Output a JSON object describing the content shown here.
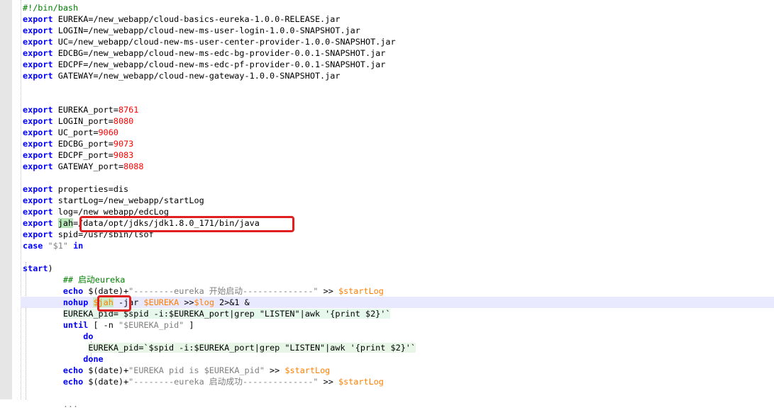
{
  "editor": {
    "lines": [
      [
        {
          "t": "#!/bin/bash",
          "c": "cm"
        }
      ],
      [
        {
          "t": "export",
          "c": "kw"
        },
        {
          "t": " EUREKA=/new_webapp/cloud-basics-eureka-1.0.0-RELEASE.jar"
        }
      ],
      [
        {
          "t": "export",
          "c": "kw"
        },
        {
          "t": " LOGIN=/new_webapp/cloud-new-ms-user-login-1.0.0-SNAPSHOT.jar"
        }
      ],
      [
        {
          "t": "export",
          "c": "kw"
        },
        {
          "t": " UC=/new_webapp/cloud-new-ms-user-center-provider-1.0.0-SNAPSHOT.jar"
        }
      ],
      [
        {
          "t": "export",
          "c": "kw"
        },
        {
          "t": " EDCBG=/new_webapp/cloud-new-ms-edc-bg-provider-0.0.1-SNAPSHOT.jar"
        }
      ],
      [
        {
          "t": "export",
          "c": "kw"
        },
        {
          "t": " EDCPF=/new_webapp/cloud-new-ms-edc-pf-provider-0.0.1-SNAPSHOT.jar"
        }
      ],
      [
        {
          "t": "export",
          "c": "kw"
        },
        {
          "t": " GATEWAY=/new_webapp/cloud-new-gateway-1.0.0-SNAPSHOT.jar"
        }
      ],
      [],
      [],
      [
        {
          "t": "export",
          "c": "kw"
        },
        {
          "t": " EUREKA_port="
        },
        {
          "t": "8761",
          "c": "num"
        }
      ],
      [
        {
          "t": "export",
          "c": "kw"
        },
        {
          "t": " LOGIN_port="
        },
        {
          "t": "8080",
          "c": "num"
        }
      ],
      [
        {
          "t": "export",
          "c": "kw"
        },
        {
          "t": " UC_port="
        },
        {
          "t": "9060",
          "c": "num"
        }
      ],
      [
        {
          "t": "export",
          "c": "kw"
        },
        {
          "t": " EDCBG_port="
        },
        {
          "t": "9073",
          "c": "num"
        }
      ],
      [
        {
          "t": "export",
          "c": "kw"
        },
        {
          "t": " EDCPF_port="
        },
        {
          "t": "9083",
          "c": "num"
        }
      ],
      [
        {
          "t": "export",
          "c": "kw"
        },
        {
          "t": " GATEWAY_port="
        },
        {
          "t": "8088",
          "c": "num"
        }
      ],
      [],
      [
        {
          "t": "export",
          "c": "kw"
        },
        {
          "t": " properties=dis"
        }
      ],
      [
        {
          "t": "export",
          "c": "kw"
        },
        {
          "t": " startLog=/new_webapp/startLog"
        }
      ],
      [
        {
          "t": "export",
          "c": "kw"
        },
        {
          "t": " log=/new_webapp/edcLog"
        }
      ],
      [
        {
          "t": "export",
          "c": "kw"
        },
        {
          "t": " "
        },
        {
          "t": "jah",
          "c": "hlg"
        },
        {
          "t": "=/data/opt/jdks/jdk1.8.0_171/bin/java"
        }
      ],
      [
        {
          "t": "export",
          "c": "kw"
        },
        {
          "t": " spid=/usr/sbin/lsof"
        }
      ],
      [
        {
          "t": "case",
          "c": "kw"
        },
        {
          "t": " "
        },
        {
          "t": "\"$1\"",
          "c": "str"
        },
        {
          "t": " "
        },
        {
          "t": "in",
          "c": "kw"
        }
      ],
      [],
      [
        {
          "t": "start",
          "c": "kw"
        },
        {
          "t": ")"
        }
      ],
      [
        {
          "t": "        "
        },
        {
          "t": "## 启动eureka",
          "c": "cm"
        }
      ],
      [
        {
          "t": "        "
        },
        {
          "t": "echo",
          "c": "kw"
        },
        {
          "t": " $(date)+"
        },
        {
          "t": "\"--------eureka 开始启动--------------\"",
          "c": "str"
        },
        {
          "t": " >> "
        },
        {
          "t": "$startLog",
          "c": "var"
        }
      ],
      [
        {
          "t": "        "
        },
        {
          "t": "nohup",
          "c": "kw"
        },
        {
          "t": " "
        },
        {
          "t": "$jah",
          "c": "hlvar"
        },
        {
          "t": " -jar "
        },
        {
          "t": "$EUREKA",
          "c": "var"
        },
        {
          "t": " >>"
        },
        {
          "t": "$log",
          "c": "var"
        },
        {
          "t": " 2>&1 &"
        }
      ],
      [
        {
          "t": "        "
        },
        {
          "t": "EUREKA_pid=`$spid -i:$EUREKA_port|grep \"LISTEN\"|awk '{print $2}'`",
          "c": "hl"
        }
      ],
      [
        {
          "t": "        "
        },
        {
          "t": "until",
          "c": "kw"
        },
        {
          "t": " [ -n "
        },
        {
          "t": "\"$EUREKA_pid\"",
          "c": "str"
        },
        {
          "t": " ]"
        }
      ],
      [
        {
          "t": "            "
        },
        {
          "t": "do",
          "c": "kw"
        }
      ],
      [
        {
          "t": "             "
        },
        {
          "t": "EUREKA_pid=`$spid -i:$EUREKA_port|grep \"LISTEN\"|awk '{print $2}'`",
          "c": "hl2"
        }
      ],
      [
        {
          "t": "            "
        },
        {
          "t": "done",
          "c": "kw"
        }
      ],
      [
        {
          "t": "        "
        },
        {
          "t": "echo",
          "c": "kw"
        },
        {
          "t": " $(date)+"
        },
        {
          "t": "\"EUREKA pid is $EUREKA_pid\"",
          "c": "str"
        },
        {
          "t": " >> "
        },
        {
          "t": "$startLog",
          "c": "var"
        }
      ],
      [
        {
          "t": "        "
        },
        {
          "t": "echo",
          "c": "kw"
        },
        {
          "t": " $(date)+"
        },
        {
          "t": "\"--------eureka 启动成功--------------\"",
          "c": "str"
        },
        {
          "t": " >> "
        },
        {
          "t": "$startLog",
          "c": "var"
        }
      ],
      [],
      [
        {
          "t": "        "
        },
        {
          "t": "...",
          "c": "str"
        }
      ]
    ],
    "current_line": 26,
    "highlight_boxes": [
      "jah-path-highlight",
      "nohup-jah-highlight"
    ]
  }
}
